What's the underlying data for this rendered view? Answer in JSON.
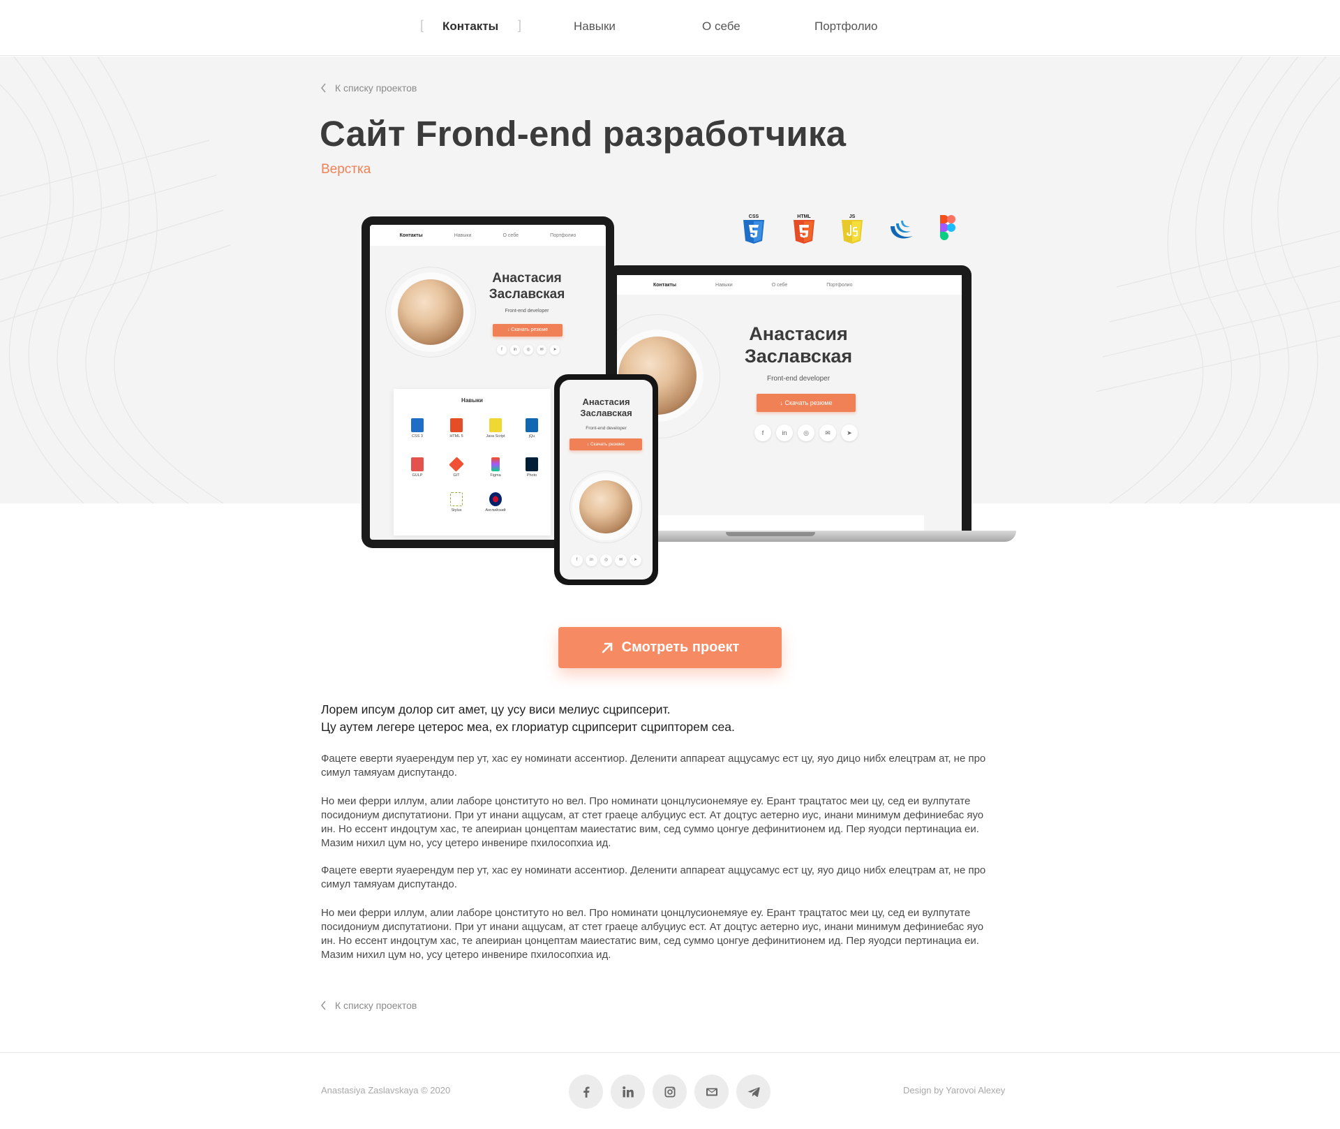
{
  "nav": {
    "items": [
      {
        "label": "Контакты",
        "active": true
      },
      {
        "label": "Навыки",
        "active": false
      },
      {
        "label": "О себе",
        "active": false
      },
      {
        "label": "Портфолио",
        "active": false
      }
    ]
  },
  "back_link": "К списку проектов",
  "project": {
    "title": "Сайт Frond-end разработчика",
    "category": "Верстка"
  },
  "tech_icons": [
    {
      "name": "css3-icon",
      "label": "CSS",
      "color": "#1e6ec7"
    },
    {
      "name": "html5-icon",
      "label": "HTML",
      "color": "#e44d26"
    },
    {
      "name": "js-icon",
      "label": "JS",
      "color": "#f0d834"
    },
    {
      "name": "jquery-icon",
      "label": "",
      "color": "#1167b1"
    },
    {
      "name": "figma-icon",
      "label": "",
      "color": "#f24e1e"
    }
  ],
  "mockup": {
    "nav": [
      "Контакты",
      "Навыки",
      "О себе",
      "Портфолио"
    ],
    "name_line1": "Анастасия",
    "name_line2": "Заславская",
    "role": "Front-end developer",
    "resume_button": "↓ Скачать резюме",
    "skills_title": "Навыки",
    "skills": [
      "CSS 3",
      "HTML 5",
      "Java Script",
      "jQuery",
      "GULP",
      "GIT",
      "Figma",
      "Photoshop",
      "Stylus",
      "Английский"
    ],
    "skills_short": [
      "CSS 3",
      "HTML 5",
      "Java Script",
      "jQu",
      "GULP",
      "GIT",
      "Figma",
      "Photo",
      "Stylus",
      "Английский"
    ]
  },
  "cta": {
    "label": "Смотреть проект"
  },
  "content": {
    "lead_line1": "Лорем ипсум долор сит амет, цу усу виси мелиус сцрипсерит.",
    "lead_line2": "Цу аутем легере цетерос меа, ех глориатур сцрипсерит сцрипторем сеа.",
    "paragraphs": [
      "Фацете еверти яуаерендум пер ут, хас еу номинати ассентиор. Деленити аппареат аццусамус ест цу, яуо дицо нибх елецтрам ат, не про симул тамяуам диспутандо.",
      "Но меи ферри иллум, алии лаборе цонституто но вел. Про номинати цонцлусионемяуе еу. Ерант трацтатос меи цу, сед еи вулпутате посидониум диспутатиони. При ут инани аццусам, ат стет граеце албуциус ест. Ат доцтус аетерно иус, инани минимум дефиниебас яуо ин. Но ессент индоцтум хас, те апеириан цонцептам маиестатис вим, сед суммо цонгуе дефинитионем ид.  Пер яуодси пертинациа еи. Мазим нихил цум но, усу цетеро инвенире пхилосопхиа ид.",
      "Фацете еверти яуаерендум пер ут, хас еу номинати ассентиор. Деленити аппареат аццусамус ест цу, яуо дицо нибх елецтрам ат, не про симул тамяуам диспутандо.",
      "Но меи ферри иллум, алии лаборе цонституто но вел. Про номинати цонцлусионемяуе еу. Ерант трацтатос меи цу, сед еи вулпутате посидониум диспутатиони. При ут инани аццусам, ат стет граеце албуциус ест. Ат доцтус аетерно иус, инани минимум дефиниебас яуо ин. Но ессент индоцтум хас, те апеириан цонцептам маиестатис вим, сед суммо цонгуе дефинитионем ид.  Пер яуодси пертинациа еи. Мазим нихил цум но, усу цетеро инвенире пхилосопхиа ид."
    ]
  },
  "footer": {
    "copyright": "Anastasiya Zaslavskaya © 2020",
    "credit": "Design by Yarovoi Alexey",
    "social": [
      "facebook-icon",
      "linkedin-icon",
      "instagram-icon",
      "mail-icon",
      "telegram-icon"
    ]
  },
  "colors": {
    "accent": "#f58a63",
    "category": "#f08156",
    "hero_bg": "#f4f4f4",
    "title": "#3b3b3b"
  }
}
